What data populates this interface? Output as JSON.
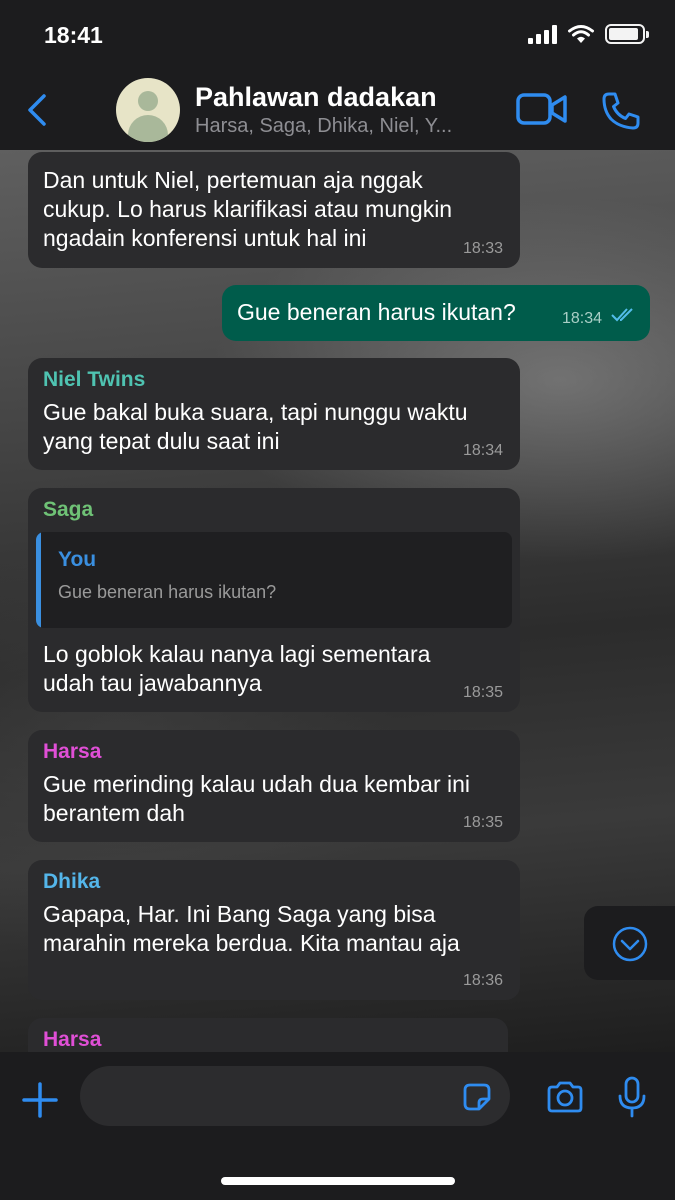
{
  "status_bar": {
    "time": "18:41"
  },
  "header": {
    "title": "Pahlawan dadakan",
    "subtitle": "Harsa, Saga, Dhika, Niel, Y..."
  },
  "messages": [
    {
      "sender": "",
      "lines": [
        "Dan untuk Niel, pertemuan aja nggak",
        "cukup. Lo harus klarifikasi atau mungkin",
        "ngadain konferensi untuk hal ini"
      ],
      "time": "18:33",
      "direction": "in"
    },
    {
      "sender": "",
      "lines": [
        "Gue beneran harus ikutan?"
      ],
      "time": "18:34",
      "direction": "out",
      "status": "read"
    },
    {
      "sender": "Niel Twins",
      "sender_color": "#4fc3b1",
      "lines": [
        "Gue bakal buka suara, tapi nunggu waktu",
        "yang tepat dulu saat ini"
      ],
      "time": "18:34",
      "direction": "in"
    },
    {
      "sender": "Saga",
      "sender_color": "#6fc276",
      "quote": {
        "name": "You",
        "text": "Gue beneran harus ikutan?"
      },
      "lines": [
        "Lo goblok kalau nanya lagi sementara",
        "udah tau jawabannya"
      ],
      "time": "18:35",
      "direction": "in"
    },
    {
      "sender": "Harsa",
      "sender_color": "#e04fd6",
      "lines": [
        "Gue merinding kalau udah dua kembar ini",
        "berantem dah"
      ],
      "time": "18:35",
      "direction": "in"
    },
    {
      "sender": "Dhika",
      "sender_color": "#54b6ea",
      "lines": [
        "Gapapa, Har. Ini Bang Saga yang bisa",
        "marahin mereka berdua. Kita mantau aja"
      ],
      "time": "18:36",
      "direction": "in"
    },
    {
      "sender": "Harsa",
      "sender_color": "#e04fd6",
      "lines": [],
      "time": "",
      "direction": "in"
    }
  ],
  "composer": {
    "value": "",
    "placeholder": ""
  },
  "colors": {
    "accent": "#2f8cf0",
    "outgoing_bubble": "#005c4b",
    "incoming_bubble": "#2b2b2d",
    "read_ticks": "#53bdeb"
  },
  "icons": [
    "back-chevron-icon",
    "video-call-icon",
    "phone-icon",
    "scroll-down-icon",
    "plus-icon",
    "sticker-icon",
    "camera-icon",
    "mic-icon"
  ]
}
